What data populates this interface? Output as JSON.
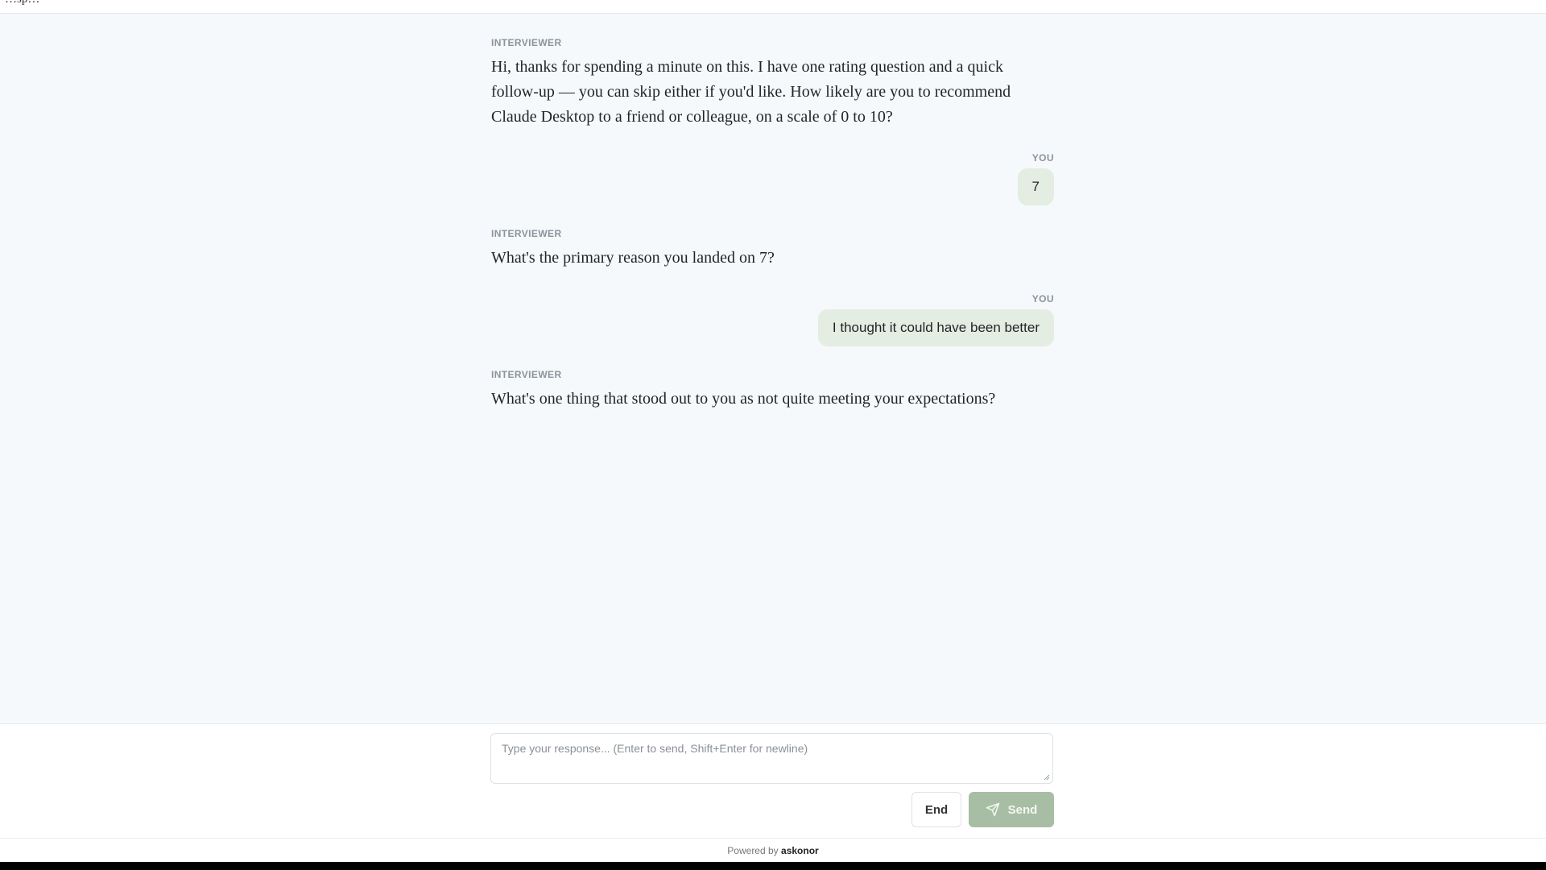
{
  "topbar": {
    "title": "…sp…"
  },
  "messages": [
    {
      "role": "interviewer",
      "label": "INTERVIEWER",
      "text": "Hi, thanks for spending a minute on this. I have one rating question and a quick follow-up — you can skip either if you'd like. How likely are you to recommend Claude Desktop to a friend or colleague, on a scale of 0 to 10?"
    },
    {
      "role": "user",
      "label": "YOU",
      "text": "7"
    },
    {
      "role": "interviewer",
      "label": "INTERVIEWER",
      "text": "What's the primary reason you landed on 7?"
    },
    {
      "role": "user",
      "label": "YOU",
      "text": "I thought it could have been better"
    },
    {
      "role": "interviewer",
      "label": "INTERVIEWER",
      "text": "What's one thing that stood out to you as not quite meeting your expectations?"
    }
  ],
  "composer": {
    "placeholder": "Type your response... (Enter to send, Shift+Enter for newline)",
    "value": "",
    "end_label": "End",
    "send_label": "Send",
    "send_icon": "paper-plane-icon",
    "accent_color": "#a8bea4"
  },
  "footer": {
    "prefix": "Powered by",
    "brand": "askonor"
  }
}
